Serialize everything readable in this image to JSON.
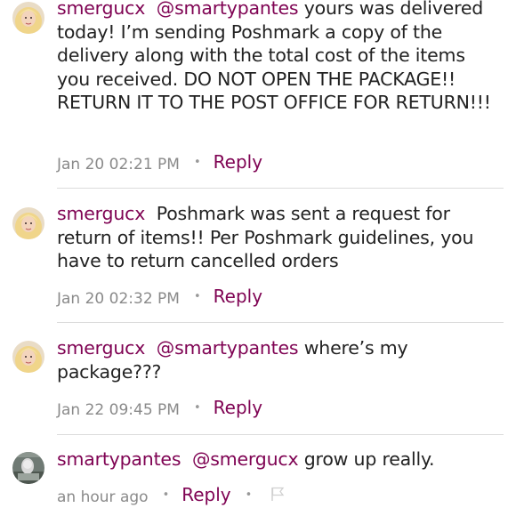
{
  "comments": [
    {
      "user": "smergucx",
      "mention": "@smartypantes",
      "text": " yours was delivered today! I’m sending Poshmark a copy of the delivery along with the total cost of the items you received. DO NOT OPEN THE PACKAGE!! RETURN IT TO THE POST OFFICE FOR RETURN!!!",
      "time": "Jan 20 02:21 PM",
      "reply_label": "Reply"
    },
    {
      "user": "smergucx",
      "mention": "",
      "text": "Poshmark was sent a request for return of items!! Per Poshmark guidelines, you have to return cancelled orders",
      "time": "Jan 20 02:32 PM",
      "reply_label": "Reply"
    },
    {
      "user": "smergucx",
      "mention": "@smartypantes",
      "text": " where’s my package???",
      "time": "Jan 22 09:45 PM",
      "reply_label": "Reply"
    },
    {
      "user": "smartypantes",
      "mention": "@smergucx",
      "text": " grow up really.",
      "time": "an hour ago",
      "reply_label": "Reply"
    }
  ],
  "separator": "•",
  "colors": {
    "accent": "#7f0353",
    "text": "#222222",
    "muted": "#8a8a8a",
    "divider": "#dcdcdc"
  }
}
